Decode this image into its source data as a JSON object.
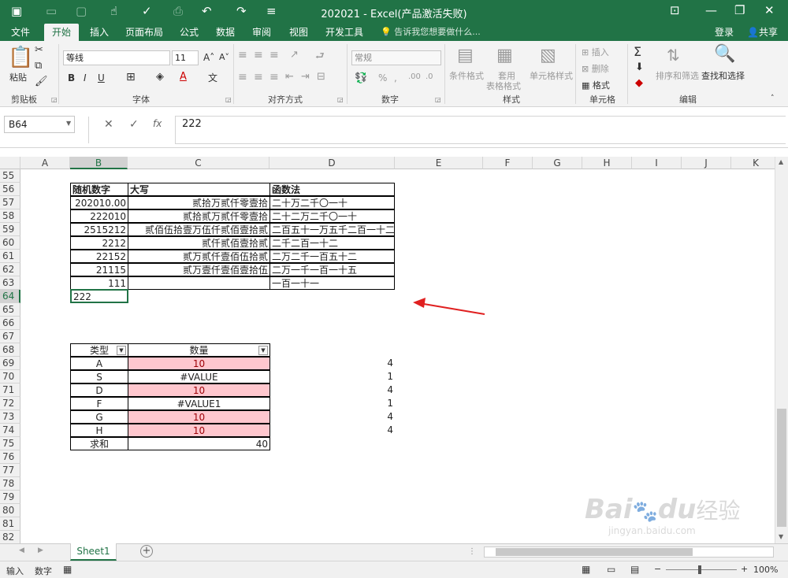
{
  "window": {
    "title": "202021 - Excel(产品激活失败)"
  },
  "tabs": [
    "文件",
    "开始",
    "插入",
    "页面布局",
    "公式",
    "数据",
    "审阅",
    "视图",
    "开发工具"
  ],
  "tell_me": "告诉我您想要做什么...",
  "account": {
    "login": "登录",
    "share": "共享"
  },
  "ribbon": {
    "paste": "粘贴",
    "font_name": "等线",
    "font_size": "11",
    "number_format": "常规",
    "cond_format": "条件格式",
    "table_format_1": "套用",
    "table_format_2": "表格格式",
    "cell_style": "单元格样式",
    "insert": "插入",
    "delete": "删除",
    "format": "格式",
    "sort_filter": "排序和筛选",
    "find_select": "查找和选择",
    "groups": {
      "clipboard": "剪贴板",
      "font": "字体",
      "align": "对齐方式",
      "number": "数字",
      "styles": "样式",
      "cells": "单元格",
      "editing": "编辑"
    },
    "font_buttons": {
      "bold": "B",
      "italic": "I",
      "underline": "U"
    },
    "autosum": "Σ"
  },
  "formula_bar": {
    "name_box": "B64",
    "content": "222",
    "fx": "fx"
  },
  "columns": [
    "A",
    "B",
    "C",
    "D",
    "E",
    "F",
    "G",
    "H",
    "I",
    "J",
    "K"
  ],
  "rows": [
    "55",
    "56",
    "57",
    "58",
    "59",
    "60",
    "61",
    "62",
    "63",
    "64",
    "65",
    "66",
    "67",
    "68",
    "69",
    "70",
    "71",
    "72",
    "73",
    "74",
    "75",
    "76",
    "77",
    "78",
    "79",
    "80",
    "81",
    "82"
  ],
  "table1": {
    "headers": [
      "随机数字",
      "大写",
      "函数法"
    ],
    "rows": [
      [
        "202010.00",
        "贰拾万贰仟零壹拾",
        "二十万二千〇一十"
      ],
      [
        "222010",
        "贰拾贰万贰仟零壹拾",
        "二十二万二千〇一十"
      ],
      [
        "2515212",
        "贰佰伍拾壹万伍仟贰佰壹拾贰",
        "二百五十一万五千二百一十二"
      ],
      [
        "2212",
        "贰仟贰佰壹拾贰",
        "二千二百一十二"
      ],
      [
        "22152",
        "贰万贰仟壹佰伍拾贰",
        "二万二千一百五十二"
      ],
      [
        "21115",
        "贰万壹仟壹佰壹拾伍",
        "二万一千一百一十五"
      ],
      [
        "111",
        "",
        "一百一十一"
      ]
    ],
    "b64": "222"
  },
  "table2": {
    "headers": [
      "类型",
      "数量"
    ],
    "rows": [
      {
        "type": "A",
        "qty": "10",
        "e": "4"
      },
      {
        "type": "S",
        "qty": "#VALUE",
        "e": "1"
      },
      {
        "type": "D",
        "qty": "10",
        "e": "4"
      },
      {
        "type": "F",
        "qty": "#VALUE1",
        "e": "1"
      },
      {
        "type": "G",
        "qty": "10",
        "e": "4"
      },
      {
        "type": "H",
        "qty": "10",
        "e": "4"
      }
    ],
    "sum_label": "求和",
    "sum_value": "40"
  },
  "sheet": {
    "name": "Sheet1",
    "add": "+"
  },
  "status": {
    "mode": "输入",
    "num": "数字",
    "zoom": "100%"
  },
  "watermark": {
    "main": "Bai",
    "du": "du",
    "cn": "经验",
    "url": "jingyan.baidu.com"
  },
  "colors": {
    "accent": "#217346",
    "pink": "#ffc7ce",
    "arrow": "#e02020"
  }
}
